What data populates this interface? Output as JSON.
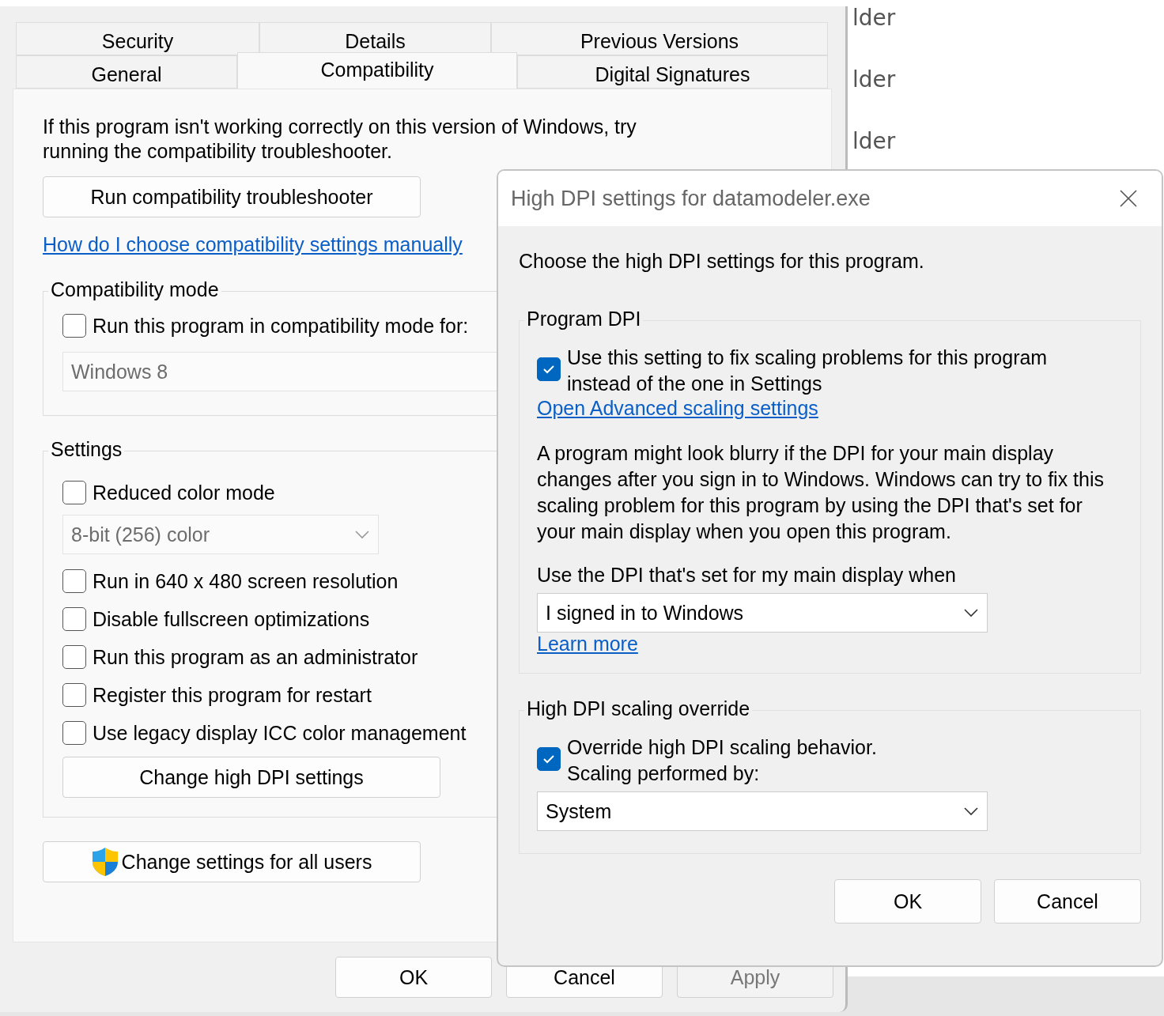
{
  "background_window": {
    "name_fragments": [
      "lder",
      "lder",
      "lder"
    ]
  },
  "properties": {
    "tab_rows": [
      [
        {
          "label": "Security",
          "selected": false
        },
        {
          "label": "Details",
          "selected": false
        },
        {
          "label": "Previous Versions",
          "selected": false
        }
      ],
      [
        {
          "label": "General",
          "selected": false
        },
        {
          "label": "Compatibility",
          "selected": true
        },
        {
          "label": "Digital Signatures",
          "selected": false
        }
      ]
    ],
    "intro": "If this program isn't working correctly on this version of Windows, try running the compatibility troubleshooter.",
    "troubleshooter_button": "Run compatibility troubleshooter",
    "help_link": "How do I choose compatibility settings manually",
    "compatibility_mode": {
      "title": "Compatibility mode",
      "checkbox": {
        "label": "Run this program in compatibility mode for:",
        "checked": false
      },
      "dropdown": {
        "value": "Windows 8",
        "disabled": true
      }
    },
    "settings": {
      "title": "Settings",
      "items": [
        {
          "kind": "checkbox",
          "label": "Reduced color mode",
          "checked": false
        },
        {
          "kind": "dropdown",
          "value": "8-bit (256) color",
          "disabled": true
        },
        {
          "kind": "checkbox",
          "label": "Run in 640 x 480 screen resolution",
          "checked": false
        },
        {
          "kind": "checkbox",
          "label": "Disable fullscreen optimizations",
          "checked": false
        },
        {
          "kind": "checkbox",
          "label": "Run this program as an administrator",
          "checked": false
        },
        {
          "kind": "checkbox",
          "label": "Register this program for restart",
          "checked": false
        },
        {
          "kind": "checkbox",
          "label": "Use legacy display ICC color management",
          "checked": false
        }
      ],
      "button": "Change high DPI settings"
    },
    "all_users_button": "Change settings for all users",
    "buttons": [
      {
        "label": "OK",
        "disabled": false
      },
      {
        "label": "Cancel",
        "disabled": false
      },
      {
        "label": "Apply",
        "disabled": true
      }
    ]
  },
  "dialog": {
    "title": "High DPI settings for datamodeler.exe",
    "prompt": "Choose the high DPI settings for this program.",
    "program_dpi": {
      "title": "Program DPI",
      "checkbox": {
        "label": "Use this setting to fix scaling problems for this program instead of the one in Settings",
        "checked": true
      },
      "link": "Open Advanced scaling settings",
      "description": "A program might look blurry if the DPI for your main display changes after you sign in to Windows. Windows can try to fix this scaling problem for this program by using the DPI that's set for your main display when you open this program.",
      "dropdown_label": "Use the DPI that's set for my main display when",
      "dropdown": {
        "value": "I signed in to Windows"
      },
      "learn_more": "Learn more"
    },
    "override": {
      "title": "High DPI scaling override",
      "checkbox": {
        "label": "Override high DPI scaling behavior.\nScaling performed by:",
        "checked": true
      },
      "dropdown": {
        "value": "System"
      }
    },
    "buttons": [
      {
        "label": "OK",
        "disabled": false
      },
      {
        "label": "Cancel",
        "disabled": false
      }
    ]
  }
}
